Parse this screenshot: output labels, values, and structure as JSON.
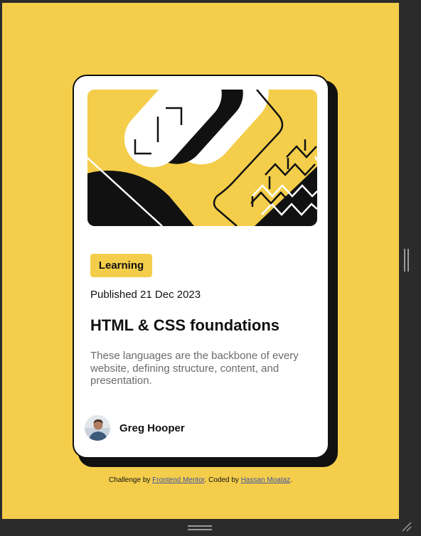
{
  "card": {
    "tag": "Learning",
    "published": "Published 21 Dec 2023",
    "title": "HTML & CSS foundations",
    "description": "These languages are the backbone of every website, defining structure, content, and presentation.",
    "author_name": "Greg Hooper"
  },
  "attribution": {
    "prefix": "Challenge by ",
    "link1": "Frontend Mentor",
    "middle": ". Coded by ",
    "link2": "Hassan Moataz",
    "suffix": "."
  },
  "colors": {
    "background": "#f4ce4b",
    "card": "#ffffff",
    "ink": "#111111",
    "muted": "#6b6b6b",
    "link": "#3e52a3",
    "window_chrome": "#2b2b2b"
  },
  "icons": {
    "illustration": "abstract-shapes-illustration",
    "avatar": "avatar-photo",
    "resize_vertical": "resize-handle-vertical-icon",
    "resize_horizontal": "resize-handle-horizontal-icon",
    "resize_corner": "resize-corner-icon"
  }
}
